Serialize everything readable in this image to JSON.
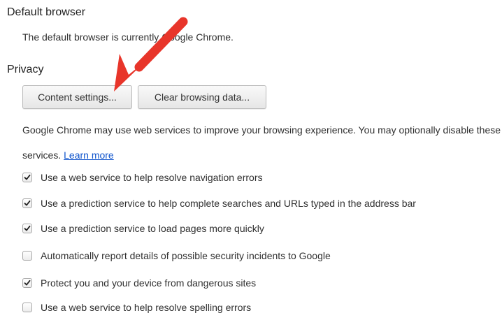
{
  "default_browser": {
    "heading": "Default browser",
    "status": "The default browser is currently Google Chrome."
  },
  "privacy": {
    "heading": "Privacy",
    "content_settings_label": "Content settings...",
    "clear_browsing_label": "Clear browsing data...",
    "description": "Google Chrome may use web services to improve your browsing experience. You may optionally disable these services.",
    "learn_more": "Learn more",
    "options": [
      {
        "label": "Use a web service to help resolve navigation errors",
        "checked": true
      },
      {
        "label": "Use a prediction service to help complete searches and URLs typed in the address bar",
        "checked": true
      },
      {
        "label": "Use a prediction service to load pages more quickly",
        "checked": true
      },
      {
        "label": "Automatically report details of possible security incidents to Google",
        "checked": false
      },
      {
        "label": "Protect you and your device from dangerous sites",
        "checked": true
      },
      {
        "label": "Use a web service to help resolve spelling errors",
        "checked": false
      }
    ]
  },
  "annotation_color": "#e8352a"
}
